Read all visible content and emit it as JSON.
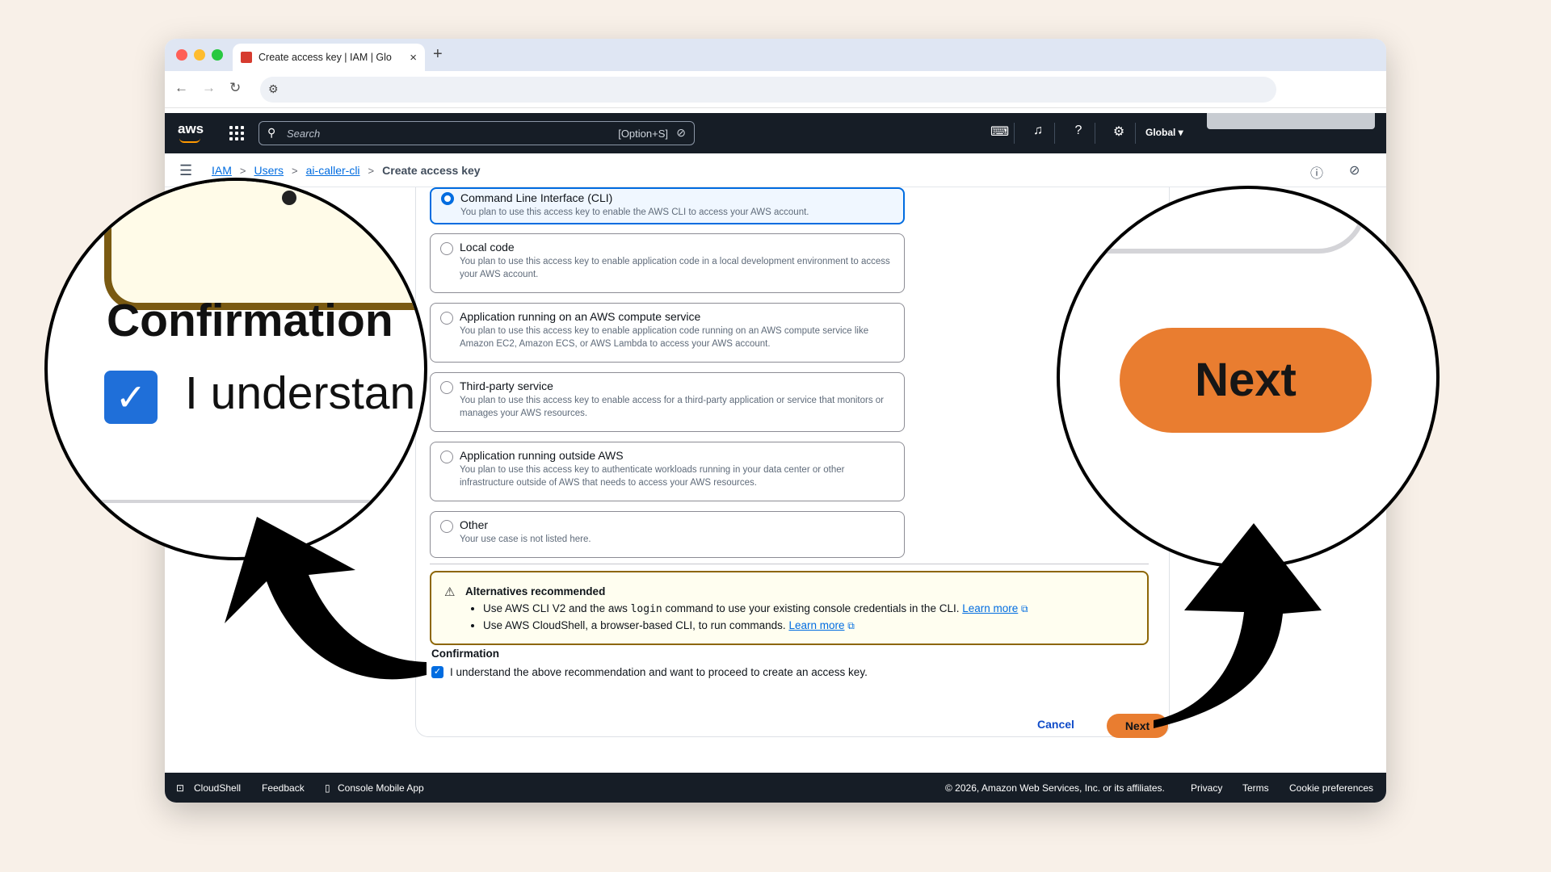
{
  "browser": {
    "tab_title": "Create access key | IAM | Glo",
    "tab_close": "×",
    "new_tab": "+"
  },
  "aws_nav": {
    "logo": "aws",
    "search_placeholder": "Search",
    "search_shortcut": "[Option+S]",
    "region": "Global ▾"
  },
  "breadcrumb": {
    "items": [
      "IAM",
      "Users",
      "ai-caller-cli"
    ],
    "current": "Create access key"
  },
  "options": [
    {
      "title": "Command Line Interface (CLI)",
      "desc": "You plan to use this access key to enable the AWS CLI to access your AWS account.",
      "selected": true
    },
    {
      "title": "Local code",
      "desc": "You plan to use this access key to enable application code in a local development environment to access your AWS account.",
      "selected": false
    },
    {
      "title": "Application running on an AWS compute service",
      "desc": "You plan to use this access key to enable application code running on an AWS compute service like Amazon EC2, Amazon ECS, or AWS Lambda to access your AWS account.",
      "selected": false
    },
    {
      "title": "Third-party service",
      "desc": "You plan to use this access key to enable access for a third-party application or service that monitors or manages your AWS resources.",
      "selected": false
    },
    {
      "title": "Application running outside AWS",
      "desc": "You plan to use this access key to authenticate workloads running in your data center or other infrastructure outside of AWS that needs to access your AWS resources.",
      "selected": false
    },
    {
      "title": "Other",
      "desc": "Your use case is not listed here.",
      "selected": false
    }
  ],
  "alert": {
    "title": "Alternatives recommended",
    "bullet1_pre": "Use AWS CLI V2 and the aws",
    "bullet1_code": "login",
    "bullet1_post": "command to use your existing console credentials in the CLI.",
    "bullet2_pre": "Use AWS CloudShell, a browser-based CLI, to run commands.",
    "learn_more": "Learn more"
  },
  "confirmation": {
    "title": "Confirmation",
    "text": "I understand the above recommendation and want to proceed to create an access key.",
    "checked": true
  },
  "actions": {
    "cancel": "Cancel",
    "next": "Next"
  },
  "footer": {
    "cloudshell": "CloudShell",
    "feedback": "Feedback",
    "mobile_app": "Console Mobile App",
    "copyright": "© 2026, Amazon Web Services, Inc. or its affiliates.",
    "privacy": "Privacy",
    "terms": "Terms",
    "cookie": "Cookie preferences"
  },
  "magnifier_left": {
    "title": "Confirmation",
    "text": "I understan"
  },
  "magnifier_right": {
    "button": "Next"
  },
  "colors": {
    "accent": "#006ce0",
    "primary_button": "#e97d30",
    "nav_bg": "#161d26",
    "page_bg": "#f8f0e8"
  }
}
